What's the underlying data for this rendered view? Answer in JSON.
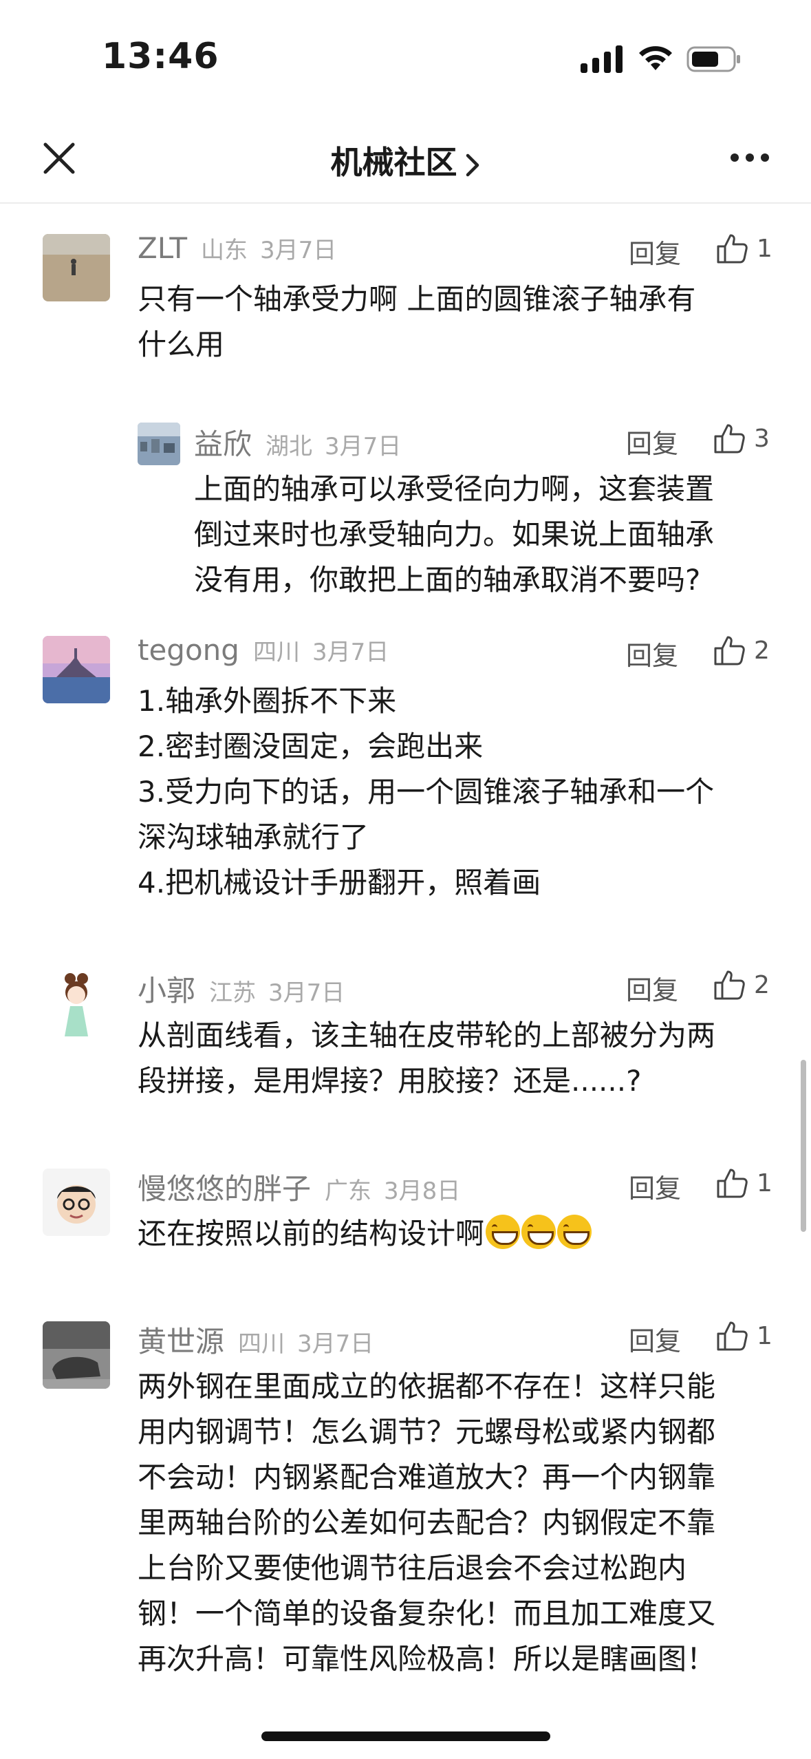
{
  "status_bar": {
    "time": "13:46"
  },
  "header": {
    "title": "机械社区",
    "icons": [
      "close-icon",
      "chevron-right-icon",
      "more-icon"
    ]
  },
  "comments": [
    {
      "name": "ZLT",
      "location": "山东",
      "date": "3月7日",
      "reply_label": "回复",
      "likes": "1",
      "text": "只有一个轴承受力啊 上面的圆锥滚子轴承有\n什么用",
      "replies": [
        {
          "name": "益欣",
          "location": "湖北",
          "date": "3月7日",
          "reply_label": "回复",
          "likes": "3",
          "text": "上面的轴承可以承受径向力啊，这套装置\n倒过来时也承受轴向力。如果说上面轴承\n没有用，你敢把上面的轴承取消不要吗?"
        }
      ]
    },
    {
      "name": "tegong",
      "location": "四川",
      "date": "3月7日",
      "reply_label": "回复",
      "likes": "2",
      "text": "1.轴承外圈拆不下来\n2.密封圈没固定，会跑出来\n3.受力向下的话，用一个圆锥滚子轴承和一个\n深沟球轴承就行了\n4.把机械设计手册翻开，照着画"
    },
    {
      "name": "小郭",
      "location": "江苏",
      "date": "3月7日",
      "reply_label": "回复",
      "likes": "2",
      "text": "从剖面线看，该主轴在皮带轮的上部被分为两\n段拼接，是用焊接？用胶接？还是......?"
    },
    {
      "name": "慢悠悠的胖子",
      "location": "广东",
      "date": "3月8日",
      "reply_label": "回复",
      "likes": "1",
      "text": "还在按照以前的结构设计啊"
    },
    {
      "name": "黄世源",
      "location": "四川",
      "date": "3月7日",
      "reply_label": "回复",
      "likes": "1",
      "text": "两外钢在里面成立的依据都不存在！这样只能\n用内钢调节！怎么调节？元螺母松或紧内钢都\n不会动！内钢紧配合难道放大？再一个内钢靠\n里两轴台阶的公差如何去配合？内钢假定不靠\n上台阶又要使他调节往后退会不会过松跑内\n钢！一个简单的设备复杂化！而且加工难度又\n再次升高！可靠性风险极高！所以是瞎画图！"
    }
  ],
  "colors": {
    "meta_gray": "#a9a9a9",
    "name_gray": "#7b7b7b",
    "text": "#1a1a1a"
  }
}
